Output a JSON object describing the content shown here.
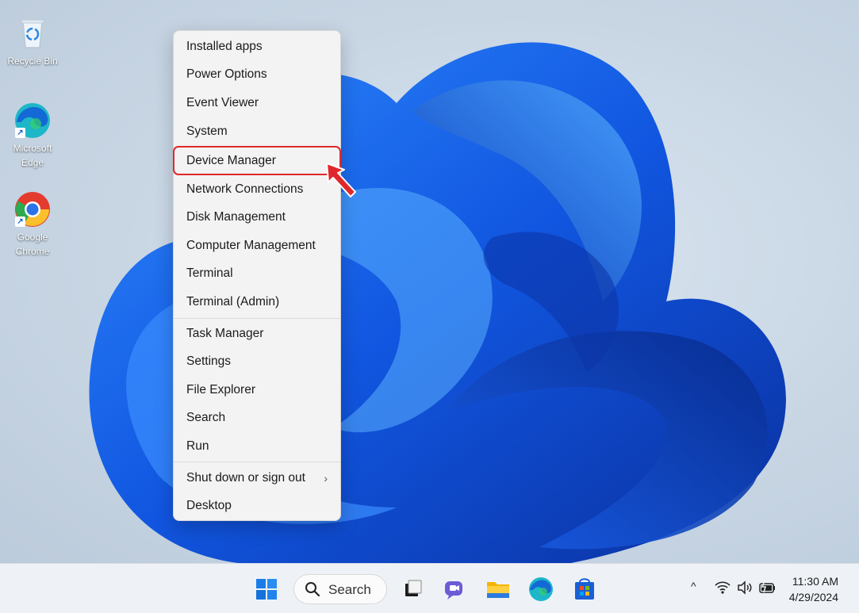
{
  "desktop": {
    "icons": [
      {
        "label_line1": "Recycle Bin",
        "label_line2": "",
        "icon": "recycle-bin-icon"
      },
      {
        "label_line1": "Microsoft",
        "label_line2": "Edge",
        "icon": "edge-icon"
      },
      {
        "label_line1": "Google",
        "label_line2": "Chrome",
        "icon": "chrome-icon"
      }
    ]
  },
  "context_menu": {
    "group1": [
      "Installed apps",
      "Power Options",
      "Event Viewer",
      "System",
      "Device Manager",
      "Network Connections",
      "Disk Management",
      "Computer Management",
      "Terminal",
      "Terminal (Admin)"
    ],
    "group2": [
      "Task Manager",
      "Settings",
      "File Explorer",
      "Search",
      "Run"
    ],
    "group3": [
      "Shut down or sign out",
      "Desktop"
    ],
    "highlighted_item": "Device Manager",
    "highlight_color": "#e0282c",
    "submenu_glyph": "›"
  },
  "taskbar": {
    "search_label": "Search",
    "pinned": [
      "start-icon",
      "search-icon",
      "task-view-icon",
      "teams-chat-icon",
      "file-explorer-icon",
      "edge-icon",
      "store-icon"
    ],
    "tray": {
      "chevron": "^",
      "icons": [
        "wifi-icon",
        "volume-icon",
        "battery-icon"
      ]
    },
    "clock": {
      "time": "11:30 AM",
      "date": "4/29/2024"
    }
  },
  "colors": {
    "accent": "#1a63e8",
    "wallpaper_blue": "#1f5fe0"
  }
}
